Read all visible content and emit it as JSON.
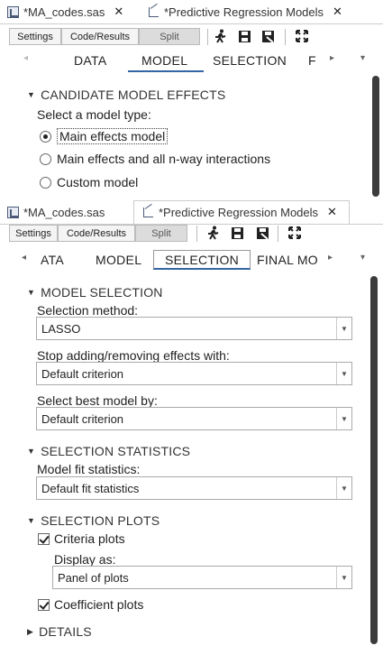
{
  "top_panel": {
    "tabs": [
      {
        "label": "*MA_codes.sas",
        "close": "✕"
      },
      {
        "label": "*Predictive Regression Models",
        "close": "✕"
      }
    ],
    "view_buttons": [
      "Settings",
      "Code/Results",
      "Split"
    ],
    "work_tabs": [
      "DATA",
      "MODEL",
      "SELECTION",
      "F"
    ],
    "active_work_tab": "MODEL",
    "section": {
      "title": "CANDIDATE MODEL EFFECTS",
      "prompt": "Select a model type:"
    },
    "options": [
      {
        "label": "Main effects model",
        "selected": true
      },
      {
        "label": "Main effects and all n-way interactions",
        "selected": false
      },
      {
        "label": "Custom model",
        "selected": false
      }
    ]
  },
  "bottom_panel": {
    "tabs": [
      {
        "label": "*MA_codes.sas",
        "close": ""
      },
      {
        "label": "*Predictive Regression Models",
        "close": "✕"
      }
    ],
    "view_buttons": [
      "Settings",
      "Code/Results",
      "Split"
    ],
    "work_tabs": [
      "ATA",
      "MODEL",
      "SELECTION",
      "FINAL MO"
    ],
    "active_work_tab": "SELECTION",
    "model_selection": {
      "title": "MODEL SELECTION",
      "method_label": "Selection method:",
      "method_value": "LASSO",
      "stop_label": "Stop adding/removing effects with:",
      "stop_value": "Default criterion",
      "best_label": "Select best model by:",
      "best_value": "Default criterion"
    },
    "selection_statistics": {
      "title": "SELECTION STATISTICS",
      "fit_label": "Model fit statistics:",
      "fit_value": "Default fit statistics"
    },
    "selection_plots": {
      "title": "SELECTION PLOTS",
      "criteria_label": "Criteria plots",
      "criteria_checked": true,
      "display_label": "Display as:",
      "display_value": "Panel of plots",
      "coef_label": "Coefficient plots",
      "coef_checked": true
    },
    "details": {
      "title": "DETAILS"
    }
  },
  "icons": [
    "run-icon",
    "save-icon",
    "save-as-icon",
    "maximize-icon",
    "chevron-left-icon",
    "chevron-right-icon",
    "chevron-down-icon"
  ],
  "colors": {
    "active_tab_underline": "#3465a4",
    "scrollbar": "#3c3c3c"
  }
}
